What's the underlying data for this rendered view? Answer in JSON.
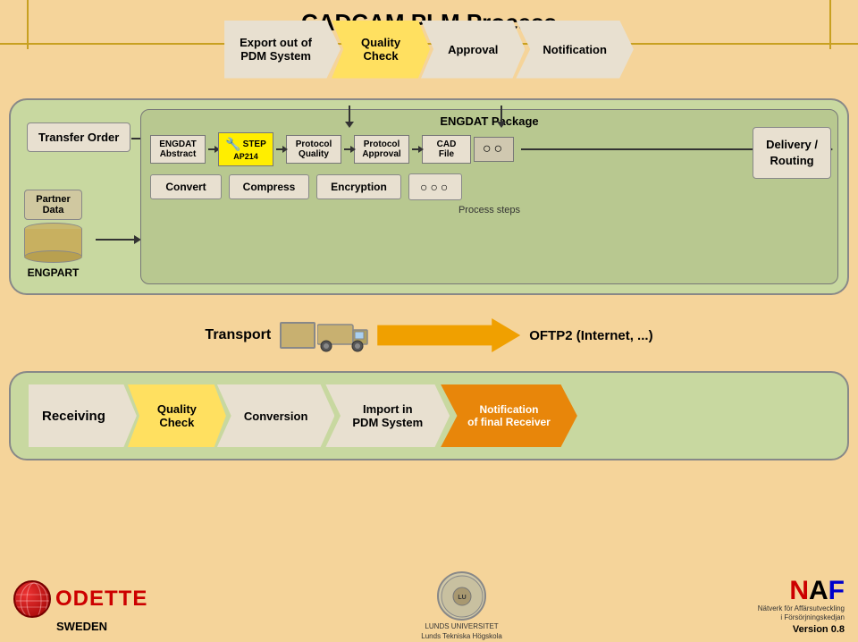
{
  "title": "CADCAM PLM Process",
  "topFlow": {
    "items": [
      {
        "id": "export-pdm",
        "label": "Export out of\nPDM System",
        "type": "first-chevron"
      },
      {
        "id": "quality-check-top",
        "label": "Quality\nCheck",
        "type": "yellow-chevron"
      },
      {
        "id": "approval",
        "label": "Approval",
        "type": "chevron"
      },
      {
        "id": "notification-top",
        "label": "Notification",
        "type": "chevron"
      }
    ]
  },
  "middleSection": {
    "transferOrderLabel": "Transfer Order",
    "engdatPackageLabel": "ENGDAT Package",
    "partnerDataLabel": "Partner\nData",
    "engpartLabel": "ENGPART",
    "deliveryRoutingLabel": "Delivery /\nRouting",
    "engdatBoxes": [
      {
        "id": "engdat-abstract",
        "label": "ENGDAT\nAbstract"
      },
      {
        "id": "step-ap214",
        "label": "STEP\nAP214",
        "yellow": true
      },
      {
        "id": "protocol-quality",
        "label": "Protocol\nQuality"
      },
      {
        "id": "protocol-approval",
        "label": "Protocol\nApproval"
      },
      {
        "id": "cad-file",
        "label": "CAD\nFile"
      },
      {
        "id": "oo-dots",
        "label": "○○",
        "dots": true
      }
    ],
    "processSteps": {
      "label": "Process steps",
      "items": [
        {
          "id": "convert",
          "label": "Convert"
        },
        {
          "id": "compress",
          "label": "Compress"
        },
        {
          "id": "encryption",
          "label": "Encryption"
        },
        {
          "id": "ooo-dots",
          "label": "○○○",
          "dots": true
        }
      ]
    }
  },
  "transport": {
    "label": "Transport",
    "oftp2Label": "OFTP2 (Internet, ...)"
  },
  "bottomSection": {
    "items": [
      {
        "id": "receiving",
        "label": "Receiving",
        "type": "first"
      },
      {
        "id": "quality-check-bottom",
        "label": "Quality\nCheck",
        "type": "yellow"
      },
      {
        "id": "conversion",
        "label": "Conversion",
        "type": "gray"
      },
      {
        "id": "import-pdm",
        "label": "Import in\nPDM System",
        "type": "gray"
      },
      {
        "id": "notification-final",
        "label": "Notification\nof final Receiver",
        "type": "orange"
      }
    ]
  },
  "footer": {
    "odette": "ODETTE",
    "sweden": "SWEDEN",
    "lunds": "LUNDS\nUNIVERSITET\nLunds Tekniska Högskola",
    "naf": "NAF",
    "nafSubtitle": "Nätverk för Affärsutveckling\ni Försörjningskedjan",
    "version": "Version 0.8"
  }
}
